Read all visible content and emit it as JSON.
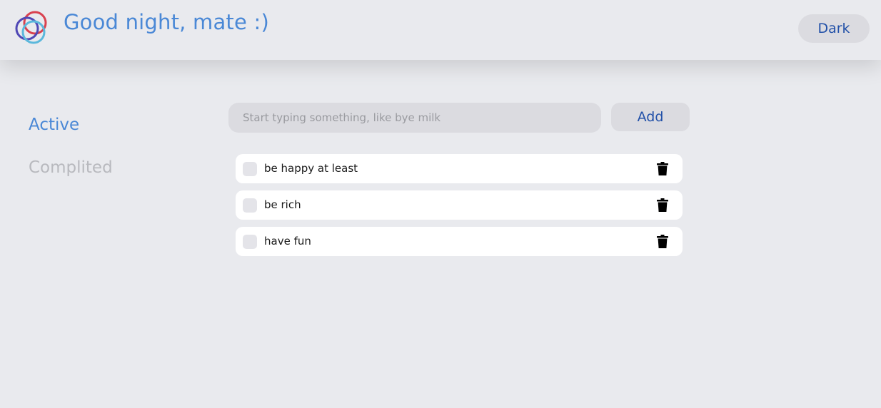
{
  "header": {
    "greeting": "Good night, mate :)",
    "theme_toggle_label": "Dark",
    "logo_colors": [
      "#d9414f",
      "#5048b5",
      "#5bb8dc"
    ]
  },
  "sidebar": {
    "items": [
      {
        "label": "Active",
        "state": "selected"
      },
      {
        "label": "Complited",
        "state": "inactive"
      }
    ]
  },
  "new_todo": {
    "placeholder": "Start typing something, like bye milk",
    "value": "",
    "add_label": "Add"
  },
  "todos": [
    {
      "text": "be happy at least",
      "done": false,
      "icon": "trash-icon"
    },
    {
      "text": "be rich",
      "done": false,
      "icon": "trash-icon"
    },
    {
      "text": "have fun",
      "done": false,
      "icon": "trash-icon"
    }
  ],
  "colors": {
    "accent": "#4a88d6",
    "button_text": "#2150a8",
    "background": "#e9eaee",
    "muted": "#b8b9be"
  }
}
